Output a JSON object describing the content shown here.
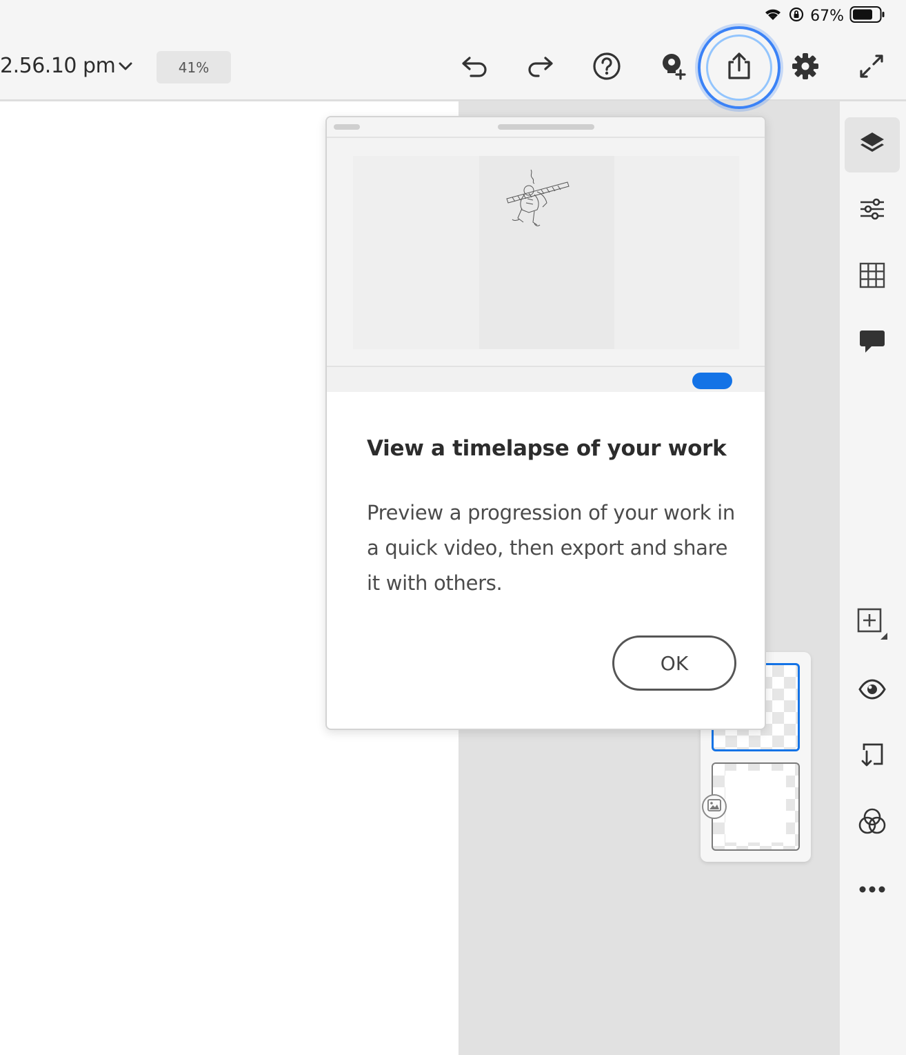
{
  "status_bar": {
    "battery_percent": "67%",
    "icons": [
      "wifi-icon",
      "orientation-lock-icon",
      "battery-icon"
    ]
  },
  "toolbar": {
    "document_title": "2.56.10 pm",
    "zoom_level": "41%",
    "buttons": [
      "undo-icon",
      "redo-icon",
      "help-icon",
      "invite-icon",
      "share-icon",
      "settings-icon",
      "fullscreen-icon"
    ],
    "highlight_color": "#3b82f6"
  },
  "right_rail": {
    "tools": [
      "layers-icon",
      "adjustments-icon",
      "grid-icon",
      "comment-icon",
      "add-layer-icon",
      "visibility-icon",
      "import-icon",
      "blend-icon",
      "more-icon"
    ],
    "active_tool": "layers-icon"
  },
  "dialog": {
    "title": "View a timelapse of your work",
    "body": "Preview a progression of your work in a quick video, then export and share it with others.",
    "ok_label": "OK",
    "accent_color": "#1473e6"
  }
}
